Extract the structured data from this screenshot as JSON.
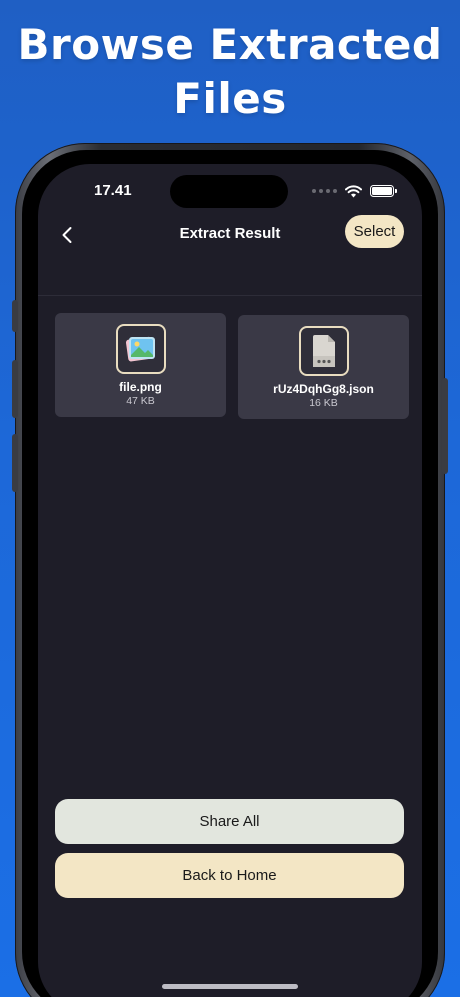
{
  "promo": {
    "headline_line1": "Browse Extracted",
    "headline_line2": "Files"
  },
  "status_bar": {
    "time": "17.41"
  },
  "navbar": {
    "title": "Extract Result",
    "select_label": "Select",
    "back_icon": "chevron-left-icon"
  },
  "files": [
    {
      "name": "file.png",
      "size": "47 KB",
      "icon": "image-file-icon"
    },
    {
      "name": "rUz4DqhGg8.json",
      "size": "16 KB",
      "icon": "document-file-icon"
    }
  ],
  "actions": {
    "share_all": "Share All",
    "back_to_home": "Back to Home"
  },
  "colors": {
    "background_blue": "#1d68d8",
    "screen_bg": "#1e1d28",
    "card_bg": "#3a3946",
    "accent_cream": "#f3e6c5",
    "share_button": "#e2e6de"
  }
}
